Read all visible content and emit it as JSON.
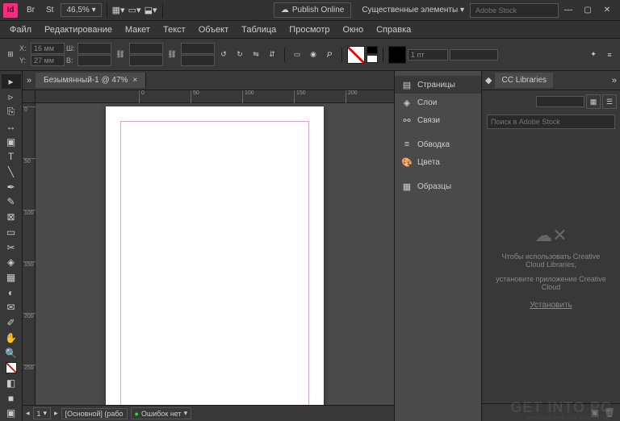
{
  "titlebar": {
    "app_abbrev": "Id",
    "mode_btn1": "Br",
    "mode_btn2": "St",
    "zoom_value": "46,5%",
    "publish_label": "Publish Online",
    "workspace_label": "Существенные элементы",
    "stock_search_placeholder": "Adobe Stock"
  },
  "menubar": [
    "Файл",
    "Редактирование",
    "Макет",
    "Текст",
    "Объект",
    "Таблица",
    "Просмотр",
    "Окно",
    "Справка"
  ],
  "controlbar": {
    "x_label": "X:",
    "y_label": "Y:",
    "x_value": "16 мм",
    "y_value": "27 мм",
    "w_label": "Ш:",
    "h_label": "В:",
    "w_value": "",
    "h_value": "",
    "stroke_value": "1 пт"
  },
  "doc_tab": {
    "title": "Безымянный-1 @ 47%"
  },
  "ruler_h": [
    "0",
    "50",
    "100",
    "150",
    "200"
  ],
  "ruler_v": [
    "0",
    "50",
    "100",
    "150",
    "200",
    "250"
  ],
  "panels": [
    {
      "icon": "pages",
      "label": "Страницы"
    },
    {
      "icon": "layers",
      "label": "Слои"
    },
    {
      "icon": "links",
      "label": "Связи"
    },
    {
      "icon": "stroke",
      "label": "Обводка"
    },
    {
      "icon": "color",
      "label": "Цвета"
    },
    {
      "icon": "swatches",
      "label": "Образцы"
    }
  ],
  "cc_libraries": {
    "title": "CC Libraries",
    "search_placeholder": "Поиск в Adobe Stock",
    "message_line1": "Чтобы использовать Creative Cloud Libraries,",
    "message_line2": "установите приложение Creative Cloud",
    "install_label": "Установить"
  },
  "statusbar": {
    "page_nav": "1",
    "master": "[Основной] (рабо",
    "errors": "Ошибок нет"
  },
  "watermark": {
    "main": "GET INTO PC",
    "sub": "Download Free Your Desired App"
  }
}
